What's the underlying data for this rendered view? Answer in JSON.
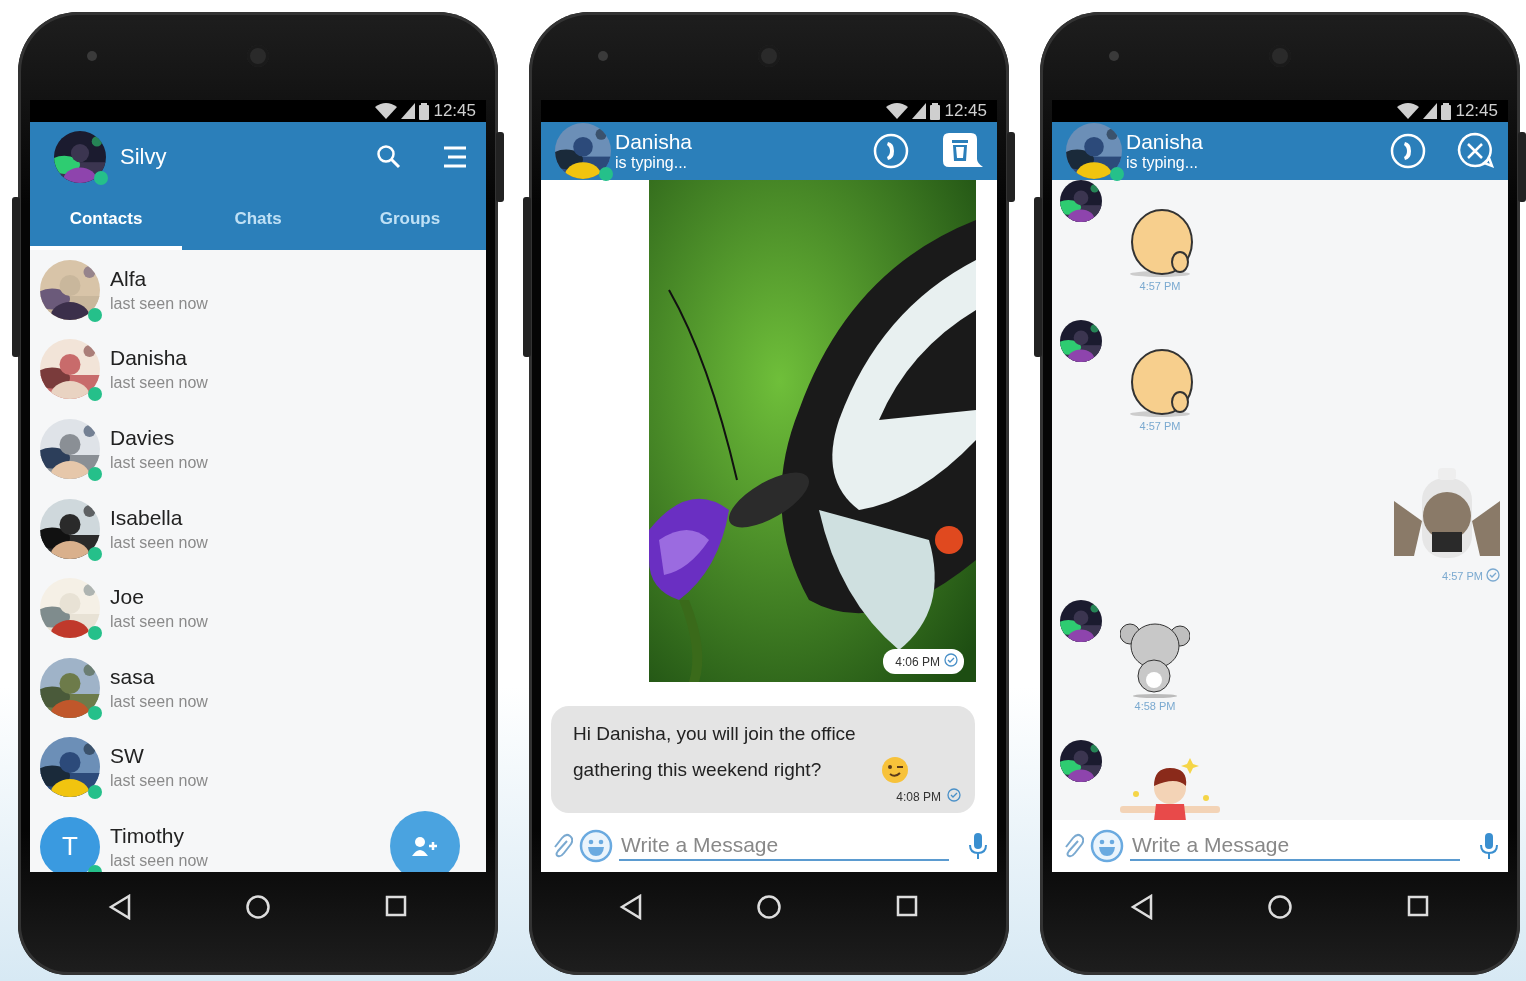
{
  "phones": [
    {
      "kind": "contacts",
      "status_bar": {
        "time": "12:45"
      },
      "header": {
        "name": "Silvy",
        "online": true
      },
      "tabs": [
        {
          "label": "Contacts",
          "selected": true
        },
        {
          "label": "Chats",
          "selected": false
        },
        {
          "label": "Groups",
          "selected": false
        }
      ],
      "contacts": [
        {
          "name": "Alfa",
          "status": "last seen now",
          "online": true
        },
        {
          "name": "Danisha",
          "status": "last seen now",
          "online": true
        },
        {
          "name": "Davies",
          "status": "last seen now",
          "online": true
        },
        {
          "name": "Isabella",
          "status": "last seen now",
          "online": true
        },
        {
          "name": "Joe",
          "status": "last seen now",
          "online": true
        },
        {
          "name": "sasa",
          "status": "last seen now",
          "online": true
        },
        {
          "name": "SW",
          "status": "last seen now",
          "online": true
        },
        {
          "name": "Timothy",
          "status": "last seen now",
          "online": true,
          "initial": "T"
        }
      ]
    },
    {
      "kind": "chat",
      "status_bar": {
        "time": "12:45"
      },
      "header": {
        "name": "Danisha",
        "status": "is typing...",
        "online": true
      },
      "messages": [
        {
          "time": "4:06 PM",
          "read": true
        },
        {
          "kind": "text",
          "text": "Hi Danisha, you will join the office gathering this weekend right?",
          "time": "4:08 PM",
          "read": true
        }
      ],
      "composer": {
        "placeholder": "Write a Message"
      }
    },
    {
      "kind": "chat",
      "status_bar": {
        "time": "12:45"
      },
      "header": {
        "name": "Danisha",
        "status": "is typing...",
        "online": true
      },
      "messages": [
        {
          "kind": "sticker",
          "outgoing": false,
          "time": "4:57 PM"
        },
        {
          "kind": "sticker",
          "outgoing": false,
          "time": "4:57 PM"
        },
        {
          "kind": "sticker",
          "outgoing": true,
          "time": "4:57 PM",
          "read": true
        },
        {
          "kind": "sticker",
          "outgoing": false,
          "time": "4:58 PM"
        },
        {
          "kind": "sticker",
          "outgoing": false
        }
      ],
      "composer": {
        "placeholder": "Write a Message"
      }
    }
  ]
}
